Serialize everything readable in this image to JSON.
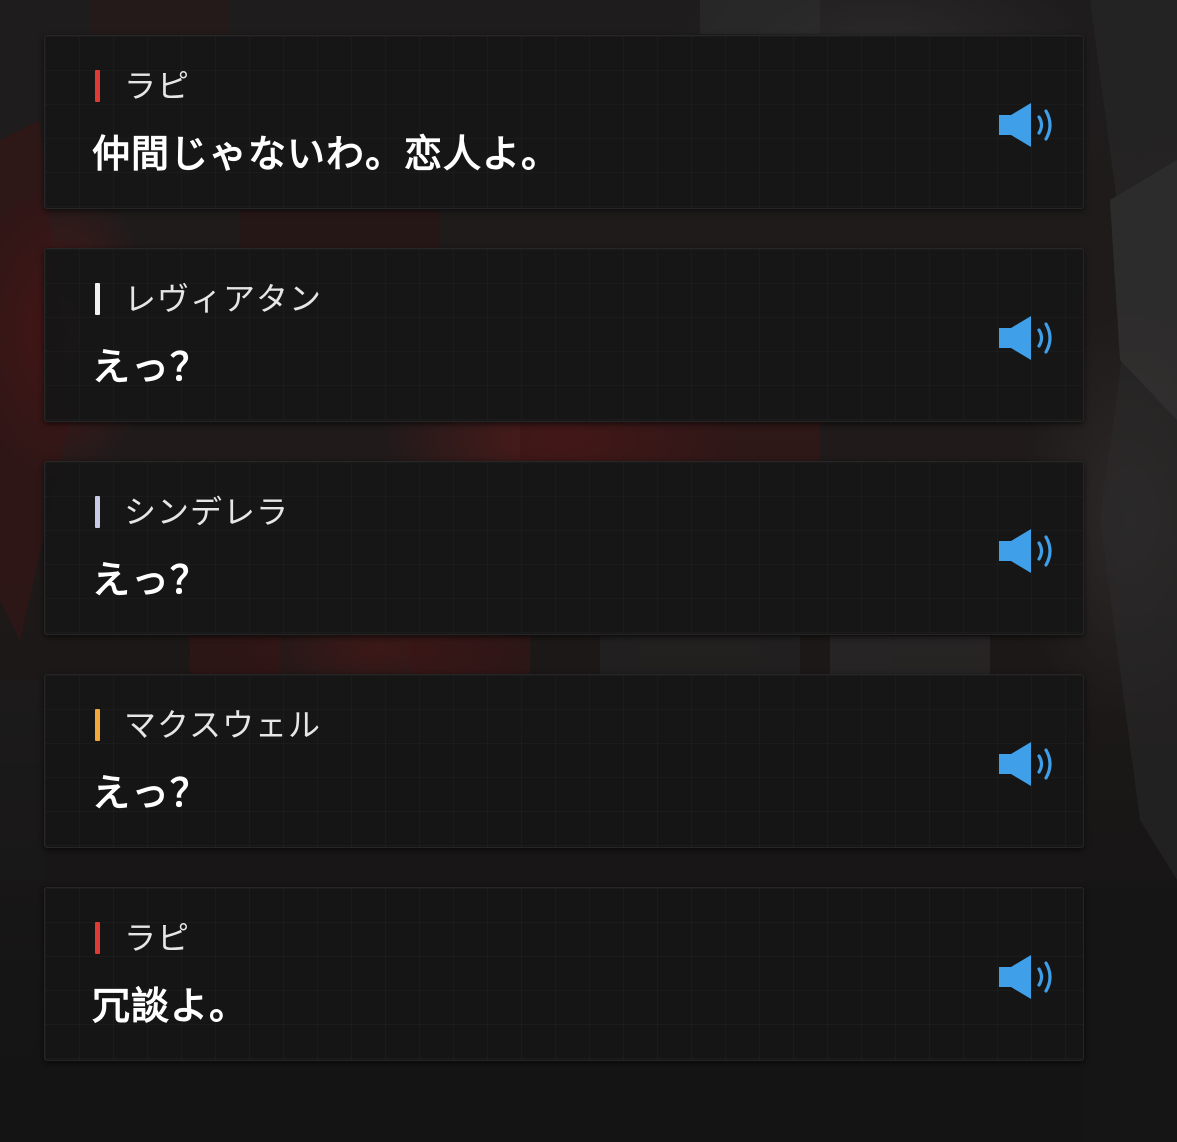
{
  "colors": {
    "speaker_icon": "#3f9fe8"
  },
  "dialog": [
    {
      "speaker": "ラピ",
      "text": "仲間じゃないわ。恋人よ。",
      "accent": "#e03a34",
      "icon": "speaker-sound-icon"
    },
    {
      "speaker": "レヴィアタン",
      "text": "えっ？",
      "accent": "#f2f2f2",
      "icon": "speaker-sound-icon"
    },
    {
      "speaker": "シンデレラ",
      "text": "えっ？",
      "accent": "#c7cbe6",
      "icon": "speaker-sound-icon"
    },
    {
      "speaker": "マクスウェル",
      "text": "えっ？",
      "accent": "#f3a93a",
      "icon": "speaker-sound-icon"
    },
    {
      "speaker": "ラピ",
      "text": "冗談よ。",
      "accent": "#e03a34",
      "icon": "speaker-sound-icon"
    }
  ]
}
